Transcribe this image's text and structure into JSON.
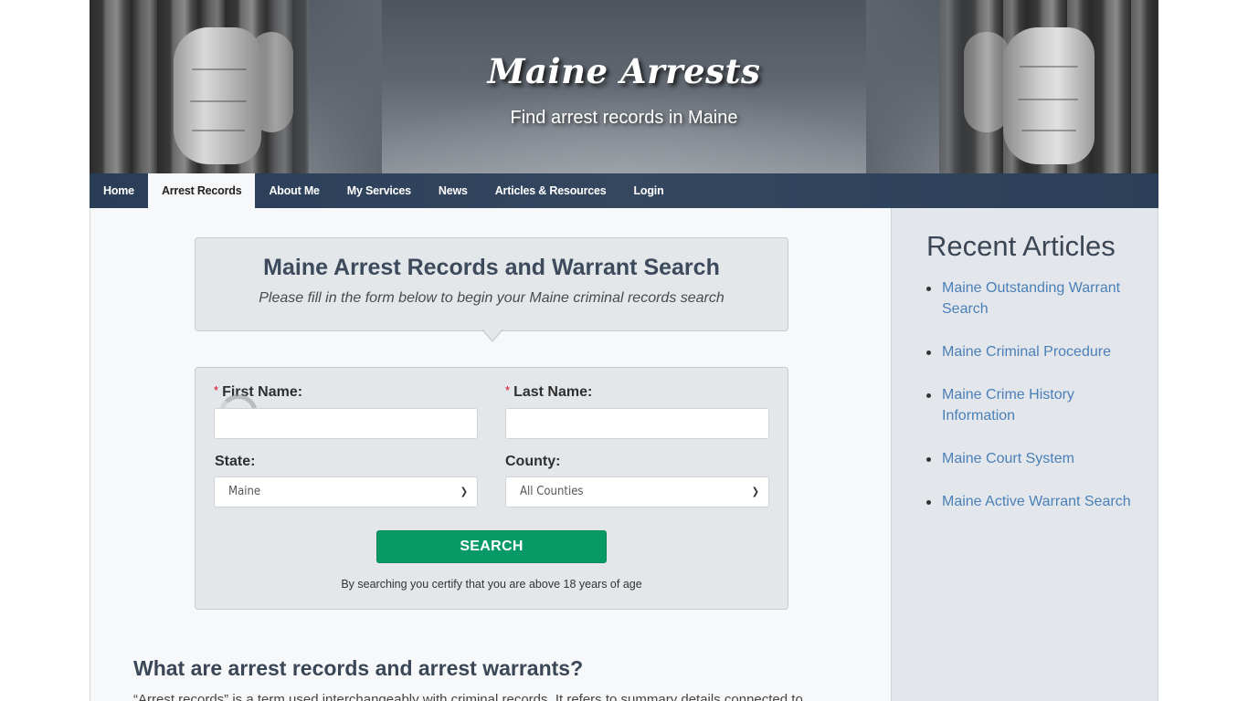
{
  "header": {
    "site_title": "Maine Arrests",
    "site_subtitle": "Find arrest records in Maine"
  },
  "nav": {
    "items": [
      {
        "label": "Home",
        "active": false
      },
      {
        "label": "Arrest Records",
        "active": true
      },
      {
        "label": "About Me",
        "active": false
      },
      {
        "label": "My Services",
        "active": false
      },
      {
        "label": "News",
        "active": false
      },
      {
        "label": "Articles & Resources",
        "active": false
      },
      {
        "label": "Login",
        "active": false
      }
    ]
  },
  "search_intro": {
    "title": "Maine Arrest Records and Warrant Search",
    "subtitle": "Please fill in the form below to begin your Maine criminal records search"
  },
  "search_form": {
    "required_marker": "*",
    "first_name": {
      "label": "First Name:",
      "value": "",
      "required": true
    },
    "last_name": {
      "label": "Last Name:",
      "value": "",
      "required": true
    },
    "state": {
      "label": "State:",
      "selected": "Maine"
    },
    "county": {
      "label": "County:",
      "selected": "All Counties"
    },
    "submit_label": "SEARCH",
    "disclaimer": "By searching you certify that you are above 18 years of age"
  },
  "article": {
    "heading": "What are arrest records and arrest warrants?",
    "text": "“Arrest records” is a term used interchangeably with criminal records. It refers to summary details connected to"
  },
  "sidebar": {
    "title": "Recent Articles",
    "articles": [
      "Maine Outstanding Warrant Search",
      "Maine Criminal Procedure",
      "Maine Crime History Information",
      "Maine Court System",
      "Maine Active Warrant Search"
    ]
  },
  "colors": {
    "nav_bg": "#2f435c",
    "accent_button": "#089a66",
    "link": "#4a7fb7",
    "heading": "#3c4a5c",
    "required": "#d0021b"
  }
}
